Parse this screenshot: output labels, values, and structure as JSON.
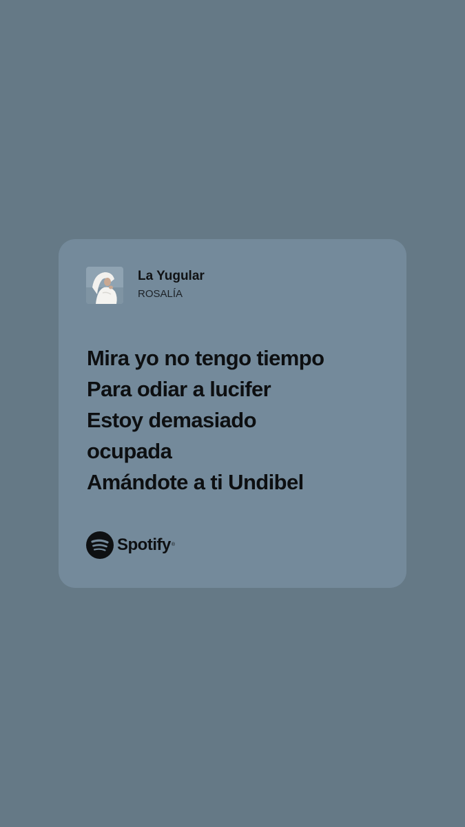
{
  "colors": {
    "background": "#657986",
    "card": "#748a9b",
    "text": "#0d0f11"
  },
  "track": {
    "title": "La Yugular",
    "artist": "ROSALÍA",
    "cover_icon": "album-cover-image"
  },
  "lyrics": [
    "Mira yo no tengo tiempo",
    "Para odiar a lucifer",
    "Estoy demasiado",
    "ocupada",
    "Amándote a ti Undibel"
  ],
  "brand": {
    "name": "Spotify",
    "mark": "®",
    "icon": "spotify-logo-icon"
  }
}
